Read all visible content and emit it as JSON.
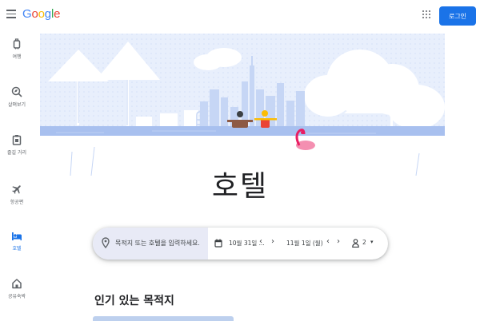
{
  "header": {
    "logo_letters": [
      {
        "ch": "G",
        "color": "#4285F4"
      },
      {
        "ch": "o",
        "color": "#EA4335"
      },
      {
        "ch": "o",
        "color": "#FBBC05"
      },
      {
        "ch": "g",
        "color": "#4285F4"
      },
      {
        "ch": "l",
        "color": "#34A853"
      },
      {
        "ch": "e",
        "color": "#EA4335"
      }
    ],
    "login_label": "로그인",
    "menu_icon": "hamburger-menu-icon",
    "apps_icon": "apps-grid-icon"
  },
  "sidebar": {
    "items": [
      {
        "label": "여행",
        "icon": "travel-bag-icon",
        "active": false
      },
      {
        "label": "살펴보기",
        "icon": "explore-icon",
        "active": false
      },
      {
        "label": "즐길 거리",
        "icon": "things-to-do-icon",
        "active": false
      },
      {
        "label": "항공편",
        "icon": "flight-icon",
        "active": false
      },
      {
        "label": "호텔",
        "icon": "hotel-bed-icon",
        "active": true
      },
      {
        "label": "공유숙박",
        "icon": "vacation-rental-icon",
        "active": false
      }
    ]
  },
  "main": {
    "title": "호텔",
    "search": {
      "destination_placeholder": "목적지 또는 호텔을 입력하세요.",
      "checkin": "10월 31일 ...",
      "checkout": "11월 1일 (월)",
      "guests": "2",
      "prev_glyph": "‹",
      "next_glyph": "›",
      "dropdown_glyph": "▾"
    },
    "section_title": "인기 있는 목적지"
  },
  "colors": {
    "accent": "#1a73e8",
    "icon_gray": "#5f6368",
    "search_field_bg": "#e8eaf6",
    "illustration_blue": "#c6d6f5",
    "pool": "#a8c0ef"
  }
}
